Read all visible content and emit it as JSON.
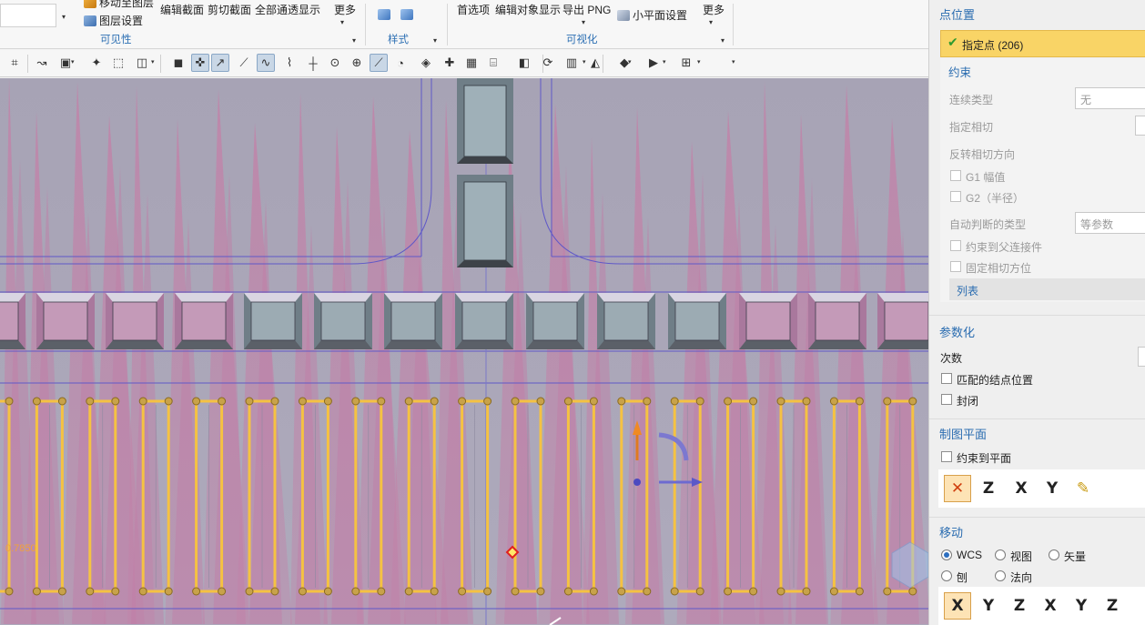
{
  "ribbon": {
    "dropdown_caret": "▾",
    "visibility_group": {
      "items": [
        "移动至图层",
        "图层设置",
        "编辑截面",
        "剪切截面",
        "全部通透显示"
      ],
      "more_label": "更多",
      "group_label": "可见性"
    },
    "style_group": {
      "group_label": "样式"
    },
    "visualize_group": {
      "items": [
        "首选项",
        "编辑对象显示",
        "导出 PNG",
        "小平面设置"
      ],
      "more_label": "更多",
      "group_label": "可视化"
    }
  },
  "toolbar": {
    "icons": [
      "snap-grid-icon",
      "bend-icon",
      "select-filter-icon",
      "measure-icon",
      "marquee-icon",
      "shaded-icon",
      "cube-icon",
      "control-point-icon",
      "endpoint-icon",
      "midpoint-icon",
      "curve-icon",
      "spline-icon",
      "intersection-icon",
      "center-icon",
      "quadrant-icon",
      "point-on-curve-icon",
      "tangent-icon",
      "surface-icon",
      "point-on-surface-icon",
      "bounded-grid-icon",
      "grid-table-icon",
      "view-fit-icon",
      "snapshot-icon",
      "refresh-icon",
      "layout-icon",
      "render-style-icon",
      "wcs-cube-icon",
      "display-icon"
    ]
  },
  "viewport": {
    "coord_readout": "0.7850"
  },
  "panel": {
    "point_location": {
      "title": "点位置",
      "specify_point_label": "指定点 (206)"
    },
    "constraints": {
      "title": "约束",
      "continuity_label": "连续类型",
      "continuity_value": "无",
      "tangent_label": "指定相切",
      "reverse_tangent_label": "反转相切方向",
      "g1_label": "G1 幅值",
      "g2_label": "G2（半径）",
      "auto_type_label": "自动判断的类型",
      "auto_type_value": "等参数",
      "parent_constraint_label": "约束到父连接件",
      "fixed_tangent_label": "固定相切方位",
      "list_label": "列表"
    },
    "parameterization": {
      "title": "参数化",
      "degree_label": "次数",
      "match_knots_label": "匹配的结点位置",
      "closed_label": "封闭"
    },
    "drawing_plane": {
      "title": "制图平面",
      "constrain_label": "约束到平面",
      "icons": [
        "plane-auto-icon",
        "plane-xy-icon",
        "plane-yz-icon",
        "plane-zx-icon",
        "plane-custom-icon"
      ],
      "icon_glyphs": [
        "✕",
        "Z",
        "X",
        "Y",
        "✎"
      ]
    },
    "move": {
      "title": "移动",
      "radio_wcs": "WCS",
      "radio_view": "视图",
      "radio_vector": "矢量",
      "radio_plane": "刨",
      "radio_normal": "法向",
      "axis_buttons": [
        "X",
        "Y",
        "Z",
        "X",
        "Y",
        "Z"
      ]
    }
  },
  "colors": {
    "accent_blue": "#2a6cb0",
    "selection_yellow": "#f9d466",
    "check_green": "#2e9a2e",
    "curve_yellow": "#f5c242",
    "marker_red": "#e02020"
  }
}
